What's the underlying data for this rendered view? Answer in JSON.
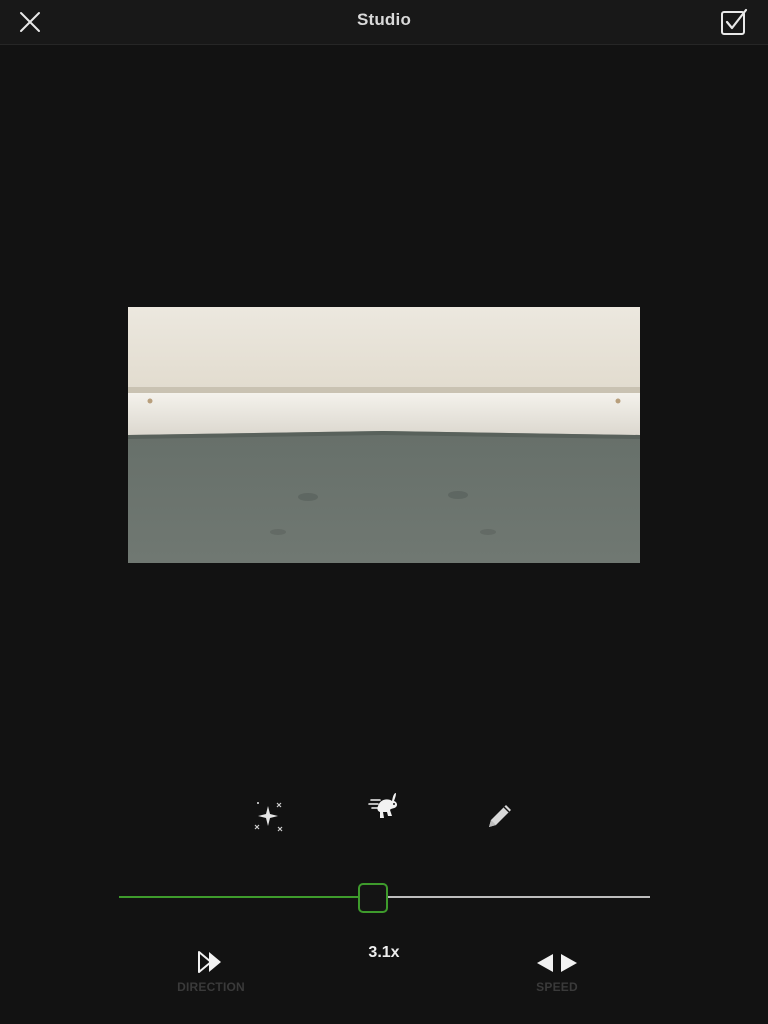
{
  "header": {
    "title": "Studio",
    "close_icon": "close-icon",
    "done_icon": "checkbox-checked-icon"
  },
  "toolbar": {
    "items": [
      {
        "name": "effects",
        "icon": "sparkle-icon"
      },
      {
        "name": "speed",
        "icon": "rabbit-icon",
        "active": true
      },
      {
        "name": "edit",
        "icon": "pencil-icon"
      }
    ]
  },
  "speed": {
    "value_label": "3.1x",
    "slider_fraction": 0.47,
    "accent_color": "#3e9b2c"
  },
  "controls": {
    "direction_label": "DIRECTION",
    "speed_label": "SPEED"
  }
}
